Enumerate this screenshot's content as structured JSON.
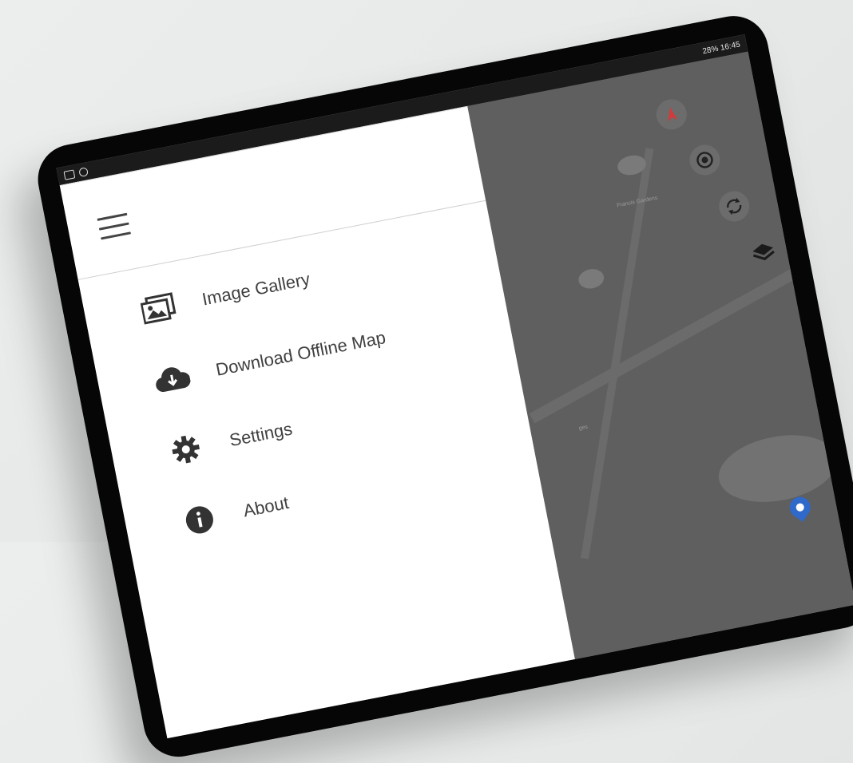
{
  "statusbar": {
    "right_text": "28% 16:45"
  },
  "drawer": {
    "items": [
      {
        "label": "Image Gallery",
        "icon": "image-gallery-icon"
      },
      {
        "label": "Download Offline Map",
        "icon": "cloud-download-icon"
      },
      {
        "label": "Settings",
        "icon": "gear-icon"
      },
      {
        "label": "About",
        "icon": "info-icon"
      }
    ]
  },
  "map": {
    "labels": [
      "Francis Gardens",
      "ges"
    ],
    "controls": [
      "compass-icon",
      "my-location-icon",
      "refresh-icon",
      "layers-icon"
    ]
  },
  "colors": {
    "pin": "#2f69c9",
    "compass_red": "#d23b3b"
  }
}
